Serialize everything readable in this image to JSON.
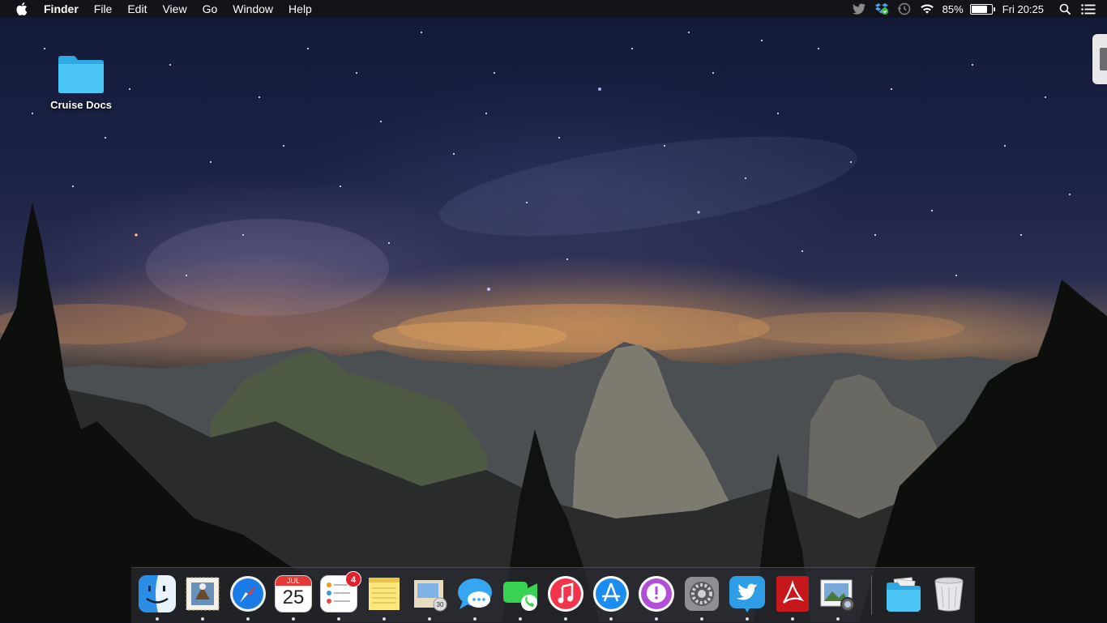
{
  "menubar": {
    "app_name": "Finder",
    "menus": [
      "File",
      "Edit",
      "View",
      "Go",
      "Window",
      "Help"
    ],
    "status_icons": [
      "twitter-icon",
      "dropbox-icon",
      "time-machine-icon",
      "wifi-icon"
    ],
    "battery_percent": "85%",
    "battery_level": 0.85,
    "clock": "Fri 20:25"
  },
  "desktop": {
    "items": [
      {
        "label": "Cruise Docs",
        "icon": "folder-icon"
      }
    ]
  },
  "dock": {
    "apps": [
      {
        "name": "Finder",
        "icon": "finder-icon",
        "running": true
      },
      {
        "name": "Mail",
        "icon": "mail-icon",
        "running": true
      },
      {
        "name": "Safari",
        "icon": "safari-icon",
        "running": true
      },
      {
        "name": "Calendar",
        "icon": "calendar-icon",
        "running": false,
        "month": "JUL",
        "day": "25"
      },
      {
        "name": "Reminders",
        "icon": "reminders-icon",
        "running": true,
        "badge": "4"
      },
      {
        "name": "Notes",
        "icon": "notes-icon",
        "running": false
      },
      {
        "name": "Contacts",
        "icon": "contacts-icon",
        "running": true
      },
      {
        "name": "Messages",
        "icon": "messages-icon",
        "running": true
      },
      {
        "name": "FaceTime",
        "icon": "facetime-icon",
        "running": false
      },
      {
        "name": "iTunes",
        "icon": "itunes-icon",
        "running": true
      },
      {
        "name": "App Store",
        "icon": "app-store-icon",
        "running": true
      },
      {
        "name": "Feedback",
        "icon": "feedback-icon",
        "running": true
      },
      {
        "name": "System Preferences",
        "icon": "system-preferences-icon",
        "running": false
      },
      {
        "name": "Twitter",
        "icon": "twitter-icon",
        "running": true
      },
      {
        "name": "Adobe Reader",
        "icon": "adobe-reader-icon",
        "running": true
      },
      {
        "name": "Preview",
        "icon": "preview-icon",
        "running": true
      }
    ],
    "stacks": [
      {
        "name": "Documents",
        "icon": "folder-stack-icon"
      },
      {
        "name": "Trash",
        "icon": "trash-icon"
      }
    ]
  },
  "colors": {
    "menubar_bg": "#141418",
    "folder_blue": "#3cbcf0",
    "badge_red": "#e0202a"
  }
}
